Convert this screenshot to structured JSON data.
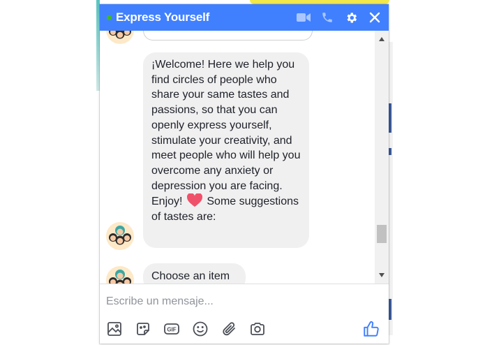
{
  "chat": {
    "title": "Express Yourself",
    "online": true,
    "accent_color": "#4080ff",
    "online_color": "#42b72a",
    "header_icons": [
      "video-call-icon",
      "phone-call-icon",
      "settings-gear-icon",
      "close-icon"
    ]
  },
  "messages": [
    {
      "type": "text",
      "text_before_emoji": "¡Welcome! Here we help you find circles of people who share your same tastes and passions, so that you can openly express yourself, stimulate your creativity, and meet people who will help you overcome any anxiety or depression you are facing. Enjoy!",
      "emoji": "heart-emoji",
      "text_after_emoji": "Some suggestions of tastes are:"
    },
    {
      "type": "choice",
      "text": "Choose an item"
    }
  ],
  "composer": {
    "placeholder": "Escribe un mensaje...",
    "tools": [
      "photo-icon",
      "sticker-icon",
      "gif-icon",
      "emoji-icon",
      "attachment-icon",
      "camera-icon"
    ],
    "like_icon": "thumbs-up-icon"
  },
  "scrollbar": {
    "position": 0.85
  }
}
